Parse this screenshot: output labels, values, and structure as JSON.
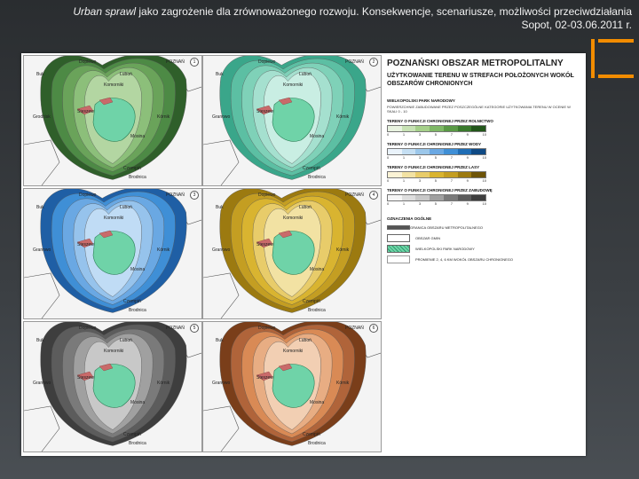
{
  "header": {
    "title_italic": "Urban sprawl",
    "title_rest": " jako zagrożenie dla zrównoważonego rozwoju. Konsekwencje, scenariusze, możliwości przeciwdziałania",
    "subtitle": "Sopot, 02-03.06.2011 r."
  },
  "colors": {
    "accent": "#f28c00",
    "green": "#6aa35a",
    "teal": "#7fd1b8",
    "blue": "#3f8fd6",
    "yellow": "#d9b430",
    "gray": "#7a7a7a",
    "orange": "#d98a55"
  },
  "maps": [
    {
      "num": "1",
      "labels": {
        "a": "Dopiewo",
        "b": "POZNAŃ",
        "c": "Buk",
        "d": "Luboń",
        "e": "Komorniki",
        "f": "Stęszew",
        "g": "Grodzisk",
        "h": "Mosina",
        "i": "Kórnik",
        "j": "Czempiń",
        "k": "Brodnica"
      }
    },
    {
      "num": "2",
      "labels": {
        "a": "Dopiewo",
        "b": "POZNAŃ",
        "c": "Buk",
        "d": "Luboń",
        "e": "Komorniki",
        "f": "Stęszew",
        "g": "Granowo",
        "h": "Mosina",
        "i": "Kórnik",
        "j": "Czempiń",
        "k": "Brodnica"
      }
    },
    {
      "num": "3",
      "labels": {
        "a": "Dopiewo",
        "b": "POZNAŃ",
        "c": "Buk",
        "d": "Luboń",
        "e": "Komorniki",
        "f": "Stęszew",
        "g": "Granowo",
        "h": "Mosina",
        "i": "Kórnik",
        "j": "Czempiń",
        "k": "Brodnica"
      }
    },
    {
      "num": "4",
      "labels": {
        "a": "Dopiewo",
        "b": "POZNAŃ",
        "c": "Buk",
        "d": "Luboń",
        "e": "Komorniki",
        "f": "Stęszew",
        "g": "Granowo",
        "h": "Mosina",
        "i": "Kórnik",
        "j": "Czempiń",
        "k": "Brodnica"
      }
    },
    {
      "num": "5",
      "labels": {
        "a": "Dopiewo",
        "b": "POZNAŃ",
        "c": "Buk",
        "d": "Luboń",
        "e": "Komorniki",
        "f": "Stęszew",
        "g": "Granowo",
        "h": "Mosina",
        "i": "Kórnik",
        "j": "Czempiń",
        "k": "Brodnica"
      }
    },
    {
      "num": "6",
      "labels": {
        "a": "Dopiewo",
        "b": "POZNAŃ",
        "c": "Buk",
        "d": "Luboń",
        "e": "Komorniki",
        "f": "Stęszew",
        "g": "Granowo",
        "h": "Mosina",
        "i": "Kórnik",
        "j": "Czempiń",
        "k": "Brodnica"
      }
    }
  ],
  "legend": {
    "title": "POZNAŃSKI OBSZAR METROPOLITALNY",
    "subtitle": "UŻYTKOWANIE TERENU W STREFACH POŁOŻONYCH WOKÓŁ OBSZARÓW CHRONIONYCH",
    "park_label": "WIELKOPOLSKI PARK NARODOWY",
    "intro": "POWIERZCHNIE ZABUDOWANE PRZEZ POSZCZEGÓLNE KATEGORIE UŻYTKOWANIA TERENU W OCENIE W SKALI 0 - 10",
    "sections": [
      {
        "head": "TERENY O FUNKCJI CHRONIONEJ PRZEZ ROLNICTWO",
        "ticks": [
          "0",
          "1",
          "3",
          "5",
          "7",
          "9",
          "10"
        ]
      },
      {
        "head": "TERENY O FUNKCJI CHRONIONEJ PRZEZ WODY",
        "ticks": [
          "0",
          "1",
          "3",
          "5",
          "7",
          "9",
          "10"
        ]
      },
      {
        "head": "TERENY O FUNKCJI CHRONIONEJ PRZEZ LASY",
        "ticks": [
          "0",
          "1",
          "3",
          "5",
          "7",
          "9",
          "10"
        ]
      },
      {
        "head": "TERENY O FUNKCJI CHRONIONEJ PRZEZ ZABUDOWĘ",
        "ticks": [
          "0",
          "1",
          "3",
          "5",
          "7",
          "9",
          "10"
        ]
      }
    ],
    "oznaczenia": "OZNACZENIA OGÓLNE",
    "items": [
      "GRANICA OBSZARU METROPOLITALNEGO",
      "OBSZAR GMIN",
      "WIELKOPOLSKI PARK NARODOWY",
      "PROMIENIE 2, 4, 6 KM WOKÓŁ OBSZARU CHRONIONEGO"
    ]
  }
}
